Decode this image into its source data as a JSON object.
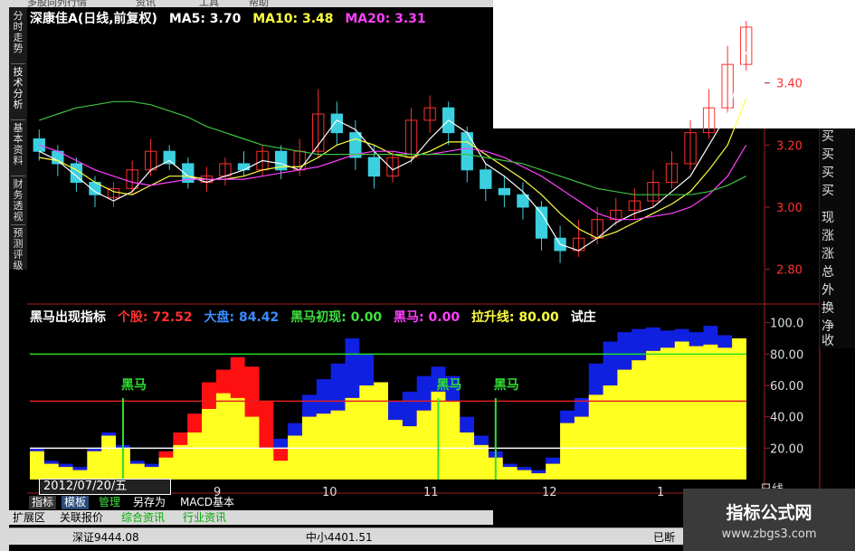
{
  "topmenu": [
    "多股同列行情",
    "资讯",
    "工具",
    "帮助"
  ],
  "side_tabs": [
    {
      "label": "分时走势",
      "active": false
    },
    {
      "label": "技术分析",
      "active": true
    },
    {
      "label": "基本资料",
      "active": false
    },
    {
      "label": "财务透视",
      "active": false
    },
    {
      "label": "预测评级",
      "active": false
    }
  ],
  "main_legend": {
    "title": "深康佳A(日线,前复权)",
    "ma5": "MA5: 3.70",
    "ma10": "MA10: 3.48",
    "ma20": "MA20: 3.31"
  },
  "indicator_legend": {
    "name": "黑马出现指标",
    "stock": "个股: 72.52",
    "market": "大盘: 84.42",
    "first": "黑马初现: 0.00",
    "horse": "黑马: 0.00",
    "pull": "拉升线: 80.00",
    "trial": "试庄"
  },
  "signals": {
    "label": "黑马"
  },
  "right_tabs": [
    "买",
    "买",
    "买",
    "买",
    "现",
    "涨",
    "涨",
    "总",
    "外",
    "换",
    "净",
    "收"
  ],
  "date": "2012/07/20/五",
  "period": "日线",
  "toolbar": [
    "指标",
    "模板",
    "管理",
    "另存为",
    "MACD基本"
  ],
  "bottom_tabs": [
    "扩展区",
    "关联报价",
    "综合资讯",
    "行业资讯"
  ],
  "status": {
    "shenzheng": "深证9444.08",
    "zhongxiao": "中小4401.51",
    "tail": "已断"
  },
  "watermark": {
    "line1": "指标公式网",
    "line2": "www.zbgs3.com"
  },
  "colors": {
    "up": "#ff3030",
    "down": "#3ad0e0",
    "ma5": "#ffffff",
    "ma10": "#ffff40",
    "ma20": "#ff40ff",
    "ma60": "#40c040",
    "red_area": "#ff1010",
    "blue_area": "#1020e0",
    "yellow_area": "#ffff20"
  },
  "chart_data": [
    {
      "type": "candlestick",
      "y_ticks": [
        3.4,
        3.2,
        3.0,
        2.8
      ],
      "ylim": [
        2.72,
        3.58
      ],
      "x_months": [
        "9",
        "10",
        "11",
        "12",
        "1"
      ],
      "series": [
        {
          "name": "MA5",
          "values": [
            3.18,
            3.15,
            3.1,
            3.05,
            3.02,
            3.05,
            3.12,
            3.15,
            3.1,
            3.08,
            3.1,
            3.12,
            3.15,
            3.14,
            3.12,
            3.2,
            3.28,
            3.25,
            3.18,
            3.12,
            3.15,
            3.22,
            3.28,
            3.24,
            3.14,
            3.1,
            3.05,
            2.98,
            2.88,
            2.86,
            2.9,
            2.95,
            2.98,
            3.0,
            3.05,
            3.1,
            3.2,
            3.3,
            3.5
          ]
        },
        {
          "name": "MA10",
          "values": [
            3.16,
            3.15,
            3.12,
            3.08,
            3.05,
            3.04,
            3.07,
            3.1,
            3.1,
            3.09,
            3.09,
            3.1,
            3.12,
            3.13,
            3.13,
            3.16,
            3.2,
            3.22,
            3.2,
            3.17,
            3.16,
            3.18,
            3.21,
            3.21,
            3.17,
            3.13,
            3.09,
            3.04,
            2.98,
            2.93,
            2.9,
            2.92,
            2.95,
            2.98,
            3.01,
            3.05,
            3.12,
            3.2,
            3.35
          ]
        },
        {
          "name": "MA20",
          "values": [
            3.2,
            3.18,
            3.15,
            3.12,
            3.1,
            3.08,
            3.07,
            3.08,
            3.09,
            3.09,
            3.09,
            3.09,
            3.1,
            3.11,
            3.12,
            3.13,
            3.15,
            3.17,
            3.18,
            3.18,
            3.17,
            3.17,
            3.18,
            3.19,
            3.18,
            3.16,
            3.13,
            3.1,
            3.06,
            3.02,
            2.98,
            2.96,
            2.96,
            2.97,
            2.98,
            3.0,
            3.04,
            3.1,
            3.2
          ]
        },
        {
          "name": "MA60",
          "values": [
            3.28,
            3.3,
            3.32,
            3.33,
            3.34,
            3.34,
            3.33,
            3.31,
            3.29,
            3.26,
            3.24,
            3.22,
            3.2,
            3.19,
            3.18,
            3.17,
            3.17,
            3.17,
            3.17,
            3.17,
            3.17,
            3.17,
            3.17,
            3.17,
            3.16,
            3.15,
            3.14,
            3.12,
            3.1,
            3.08,
            3.06,
            3.05,
            3.04,
            3.04,
            3.04,
            3.04,
            3.05,
            3.07,
            3.1
          ]
        }
      ],
      "candles": [
        [
          3.22,
          3.18,
          3.25,
          3.15
        ],
        [
          3.18,
          3.14,
          3.2,
          3.1
        ],
        [
          3.14,
          3.08,
          3.16,
          3.05
        ],
        [
          3.08,
          3.04,
          3.1,
          3.0
        ],
        [
          3.03,
          3.06,
          3.08,
          3.0
        ],
        [
          3.06,
          3.12,
          3.15,
          3.04
        ],
        [
          3.12,
          3.18,
          3.22,
          3.1
        ],
        [
          3.18,
          3.14,
          3.2,
          3.12
        ],
        [
          3.14,
          3.08,
          3.16,
          3.06
        ],
        [
          3.08,
          3.1,
          3.13,
          3.05
        ],
        [
          3.1,
          3.14,
          3.16,
          3.07
        ],
        [
          3.14,
          3.12,
          3.18,
          3.1
        ],
        [
          3.12,
          3.18,
          3.2,
          3.1
        ],
        [
          3.18,
          3.12,
          3.2,
          3.09
        ],
        [
          3.12,
          3.18,
          3.22,
          3.1
        ],
        [
          3.18,
          3.3,
          3.38,
          3.16
        ],
        [
          3.3,
          3.24,
          3.34,
          3.2
        ],
        [
          3.24,
          3.16,
          3.28,
          3.12
        ],
        [
          3.16,
          3.1,
          3.2,
          3.06
        ],
        [
          3.1,
          3.16,
          3.18,
          3.08
        ],
        [
          3.16,
          3.28,
          3.32,
          3.14
        ],
        [
          3.28,
          3.32,
          3.36,
          3.24
        ],
        [
          3.32,
          3.24,
          3.34,
          3.2
        ],
        [
          3.24,
          3.12,
          3.26,
          3.08
        ],
        [
          3.12,
          3.06,
          3.14,
          3.02
        ],
        [
          3.06,
          3.04,
          3.1,
          3.0
        ],
        [
          3.04,
          3.0,
          3.08,
          2.96
        ],
        [
          3.0,
          2.9,
          3.02,
          2.86
        ],
        [
          2.9,
          2.86,
          2.94,
          2.82
        ],
        [
          2.86,
          2.9,
          2.96,
          2.84
        ],
        [
          2.9,
          2.96,
          3.0,
          2.88
        ],
        [
          2.96,
          2.99,
          3.03,
          2.94
        ],
        [
          2.99,
          3.02,
          3.06,
          2.96
        ],
        [
          3.02,
          3.08,
          3.12,
          3.0
        ],
        [
          3.08,
          3.14,
          3.18,
          3.06
        ],
        [
          3.14,
          3.24,
          3.28,
          3.12
        ],
        [
          3.24,
          3.32,
          3.38,
          3.22
        ],
        [
          3.32,
          3.46,
          3.52,
          3.3
        ],
        [
          3.46,
          3.58,
          3.6,
          3.44
        ]
      ]
    },
    {
      "type": "area",
      "y_ticks": [
        100.0,
        80.0,
        60.0,
        40.0,
        20.0
      ],
      "ylim": [
        0,
        105
      ],
      "reference_lines": [
        80,
        50,
        20
      ],
      "signal_positions": [
        6,
        28,
        32
      ],
      "x_months": [
        "9",
        "10",
        "11",
        "12",
        "1"
      ],
      "series": [
        {
          "name": "黄",
          "values": [
            18,
            10,
            8,
            6,
            18,
            28,
            20,
            10,
            8,
            14,
            22,
            30,
            45,
            55,
            52,
            40,
            20,
            12,
            28,
            40,
            42,
            44,
            52,
            60,
            62,
            38,
            34,
            44,
            56,
            50,
            30,
            22,
            14,
            8,
            6,
            4,
            10,
            36,
            40,
            54,
            60,
            70,
            76,
            82,
            84,
            88,
            85,
            86,
            84,
            90
          ]
        },
        {
          "name": "红",
          "values": [
            18,
            10,
            8,
            6,
            18,
            28,
            20,
            10,
            8,
            18,
            30,
            42,
            62,
            70,
            78,
            72,
            50,
            20,
            28,
            40,
            42,
            44,
            52,
            60,
            62,
            38,
            34,
            44,
            56,
            50,
            30,
            22,
            14,
            8,
            6,
            4,
            10,
            36,
            40,
            54,
            60,
            70,
            76,
            82,
            84,
            88,
            85,
            86,
            84,
            90
          ]
        },
        {
          "name": "蓝",
          "values": [
            20,
            12,
            10,
            8,
            20,
            30,
            22,
            12,
            10,
            18,
            30,
            42,
            62,
            70,
            78,
            72,
            50,
            26,
            36,
            54,
            64,
            74,
            90,
            80,
            60,
            50,
            56,
            66,
            72,
            66,
            40,
            28,
            18,
            10,
            8,
            6,
            14,
            44,
            52,
            74,
            88,
            94,
            96,
            97,
            95,
            96,
            94,
            98,
            92,
            80
          ]
        }
      ]
    }
  ]
}
